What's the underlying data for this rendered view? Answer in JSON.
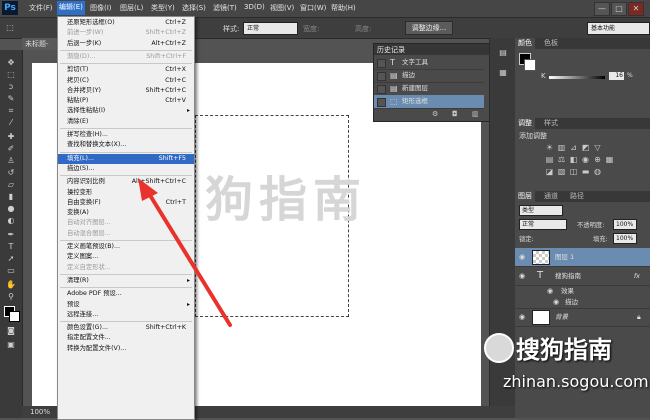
{
  "app": {
    "logo": "Ps",
    "window_controls": [
      "—",
      "□",
      "✕"
    ]
  },
  "menubar": {
    "items": [
      "文件(F)",
      "编辑(E)",
      "图像(I)",
      "图层(L)",
      "类型(Y)",
      "选择(S)",
      "滤镜(T)",
      "3D(D)",
      "视图(V)",
      "窗口(W)",
      "帮助(H)"
    ],
    "active_index": 1
  },
  "options_bar": {
    "style_label": "样式:",
    "style_value": "正常",
    "width_label": "宽度:",
    "height_label": "高度:",
    "refine_edge": "调整边缘...",
    "workspace": "基本功能"
  },
  "document": {
    "tab_label": "未标题-",
    "zoom": "100%"
  },
  "edit_menu": {
    "items": [
      {
        "label": "还原矩形选框(O)",
        "shortcut": "Ctrl+Z",
        "disabled": false
      },
      {
        "label": "前进一步(W)",
        "shortcut": "Shift+Ctrl+Z",
        "disabled": true
      },
      {
        "label": "后退一步(K)",
        "shortcut": "Alt+Ctrl+Z",
        "disabled": false
      },
      {
        "sep": true
      },
      {
        "label": "渐隐(D)...",
        "shortcut": "Shift+Ctrl+F",
        "disabled": true
      },
      {
        "sep": true
      },
      {
        "label": "剪切(T)",
        "shortcut": "Ctrl+X",
        "disabled": false
      },
      {
        "label": "拷贝(C)",
        "shortcut": "Ctrl+C",
        "disabled": false
      },
      {
        "label": "合并拷贝(Y)",
        "shortcut": "Shift+Ctrl+C",
        "disabled": false
      },
      {
        "label": "粘贴(P)",
        "shortcut": "Ctrl+V",
        "disabled": false
      },
      {
        "label": "选择性粘贴(I)",
        "shortcut": "",
        "disabled": false,
        "submenu": true
      },
      {
        "label": "清除(E)",
        "shortcut": "",
        "disabled": false
      },
      {
        "sep": true
      },
      {
        "label": "拼写检查(H)...",
        "shortcut": "",
        "disabled": false
      },
      {
        "label": "查找和替换文本(X)...",
        "shortcut": "",
        "disabled": false
      },
      {
        "sep": true
      },
      {
        "label": "填充(L)...",
        "shortcut": "Shift+F5",
        "disabled": false,
        "highlighted": true
      },
      {
        "label": "描边(S)...",
        "shortcut": "",
        "disabled": false
      },
      {
        "sep": true
      },
      {
        "label": "内容识别比例",
        "shortcut": "Alt+Shift+Ctrl+C",
        "disabled": false
      },
      {
        "label": "操控变形",
        "shortcut": "",
        "disabled": false
      },
      {
        "label": "自由变换(F)",
        "shortcut": "Ctrl+T",
        "disabled": false
      },
      {
        "label": "变换(A)",
        "shortcut": "",
        "disabled": false
      },
      {
        "label": "自动对齐图层...",
        "shortcut": "",
        "disabled": true
      },
      {
        "label": "自动混合图层...",
        "shortcut": "",
        "disabled": true
      },
      {
        "sep": true
      },
      {
        "label": "定义画笔预设(B)...",
        "shortcut": "",
        "disabled": false
      },
      {
        "label": "定义图案...",
        "shortcut": "",
        "disabled": false
      },
      {
        "label": "定义自定形状...",
        "shortcut": "",
        "disabled": true
      },
      {
        "sep": true
      },
      {
        "label": "清理(R)",
        "shortcut": "",
        "disabled": false,
        "submenu": true
      },
      {
        "sep": true
      },
      {
        "label": "Adobe PDF 预设...",
        "shortcut": "",
        "disabled": false
      },
      {
        "label": "预设",
        "shortcut": "",
        "disabled": false,
        "submenu": true
      },
      {
        "label": "远程连接...",
        "shortcut": "",
        "disabled": false
      },
      {
        "sep": true
      },
      {
        "label": "颜色设置(G)...",
        "shortcut": "Shift+Ctrl+K",
        "disabled": false
      },
      {
        "label": "指定配置文件...",
        "shortcut": "",
        "disabled": false
      },
      {
        "label": "转换为配置文件(V)...",
        "shortcut": "",
        "disabled": false
      }
    ]
  },
  "history": {
    "title": "历史记录",
    "rows": [
      {
        "label": "文字工具",
        "icon": "T",
        "selected": false
      },
      {
        "label": "描边",
        "icon": "▤",
        "selected": false
      },
      {
        "label": "新建图层",
        "icon": "▤",
        "selected": false
      },
      {
        "label": "矩形选框",
        "icon": "⬚",
        "selected": true
      }
    ]
  },
  "color_panel": {
    "tabs": [
      "颜色",
      "色板"
    ],
    "channel": "K",
    "value": "16",
    "unit": "%"
  },
  "adjust_panel": {
    "tabs": [
      "调整",
      "样式"
    ],
    "title": "添加调整"
  },
  "layers_panel": {
    "tabs": [
      "图层",
      "通道",
      "路径"
    ],
    "kind": "类型",
    "blend": "正常",
    "opacity_label": "不透明度:",
    "opacity": "100%",
    "lock_label": "锁定:",
    "fill_label": "填充:",
    "fill": "100%",
    "layers": [
      {
        "name": "图层 1",
        "type": "pixel",
        "selected": true
      },
      {
        "name": "搜狗指南",
        "type": "text",
        "selected": false,
        "fx": "fx"
      },
      {
        "name": "效果",
        "type": "effect",
        "selected": false
      },
      {
        "name": "描边",
        "type": "effect",
        "selected": false
      },
      {
        "name": "背景",
        "type": "background",
        "selected": false
      }
    ]
  },
  "watermark": {
    "canvas_text": "狗指南",
    "brand": "搜狗指南",
    "url": "zhinan.sogou.com"
  },
  "accent": {
    "highlight": "#316ac5",
    "arrow": "#e8322b"
  }
}
